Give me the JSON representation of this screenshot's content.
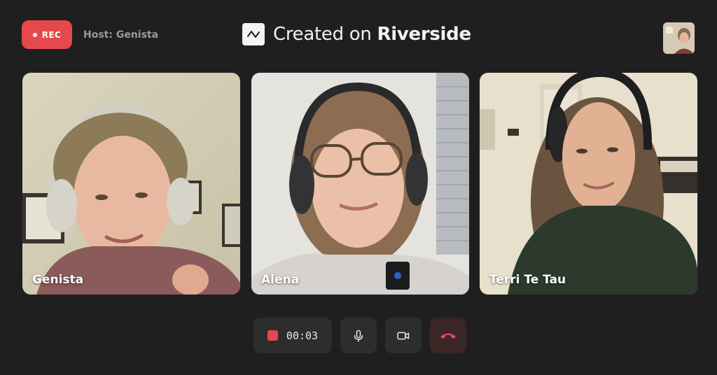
{
  "header": {
    "rec_label": "REC",
    "host_label": "Host: Genista",
    "brand_prefix": "Created on ",
    "brand_name": "Riverside"
  },
  "participants": [
    {
      "name": "Genista"
    },
    {
      "name": "Alena"
    },
    {
      "name": "Terri Te Tau"
    }
  ],
  "controls": {
    "timer": "00:03",
    "mic_icon": "microphone-icon",
    "camera_icon": "video-camera-icon",
    "hangup_icon": "phone-hangup-icon"
  },
  "colors": {
    "background": "#1f1f1f",
    "record_red": "#e5484d",
    "button_bg": "#2d2d2d",
    "hangup_bg": "#3a2626",
    "muted_text": "#9a9a9a"
  }
}
